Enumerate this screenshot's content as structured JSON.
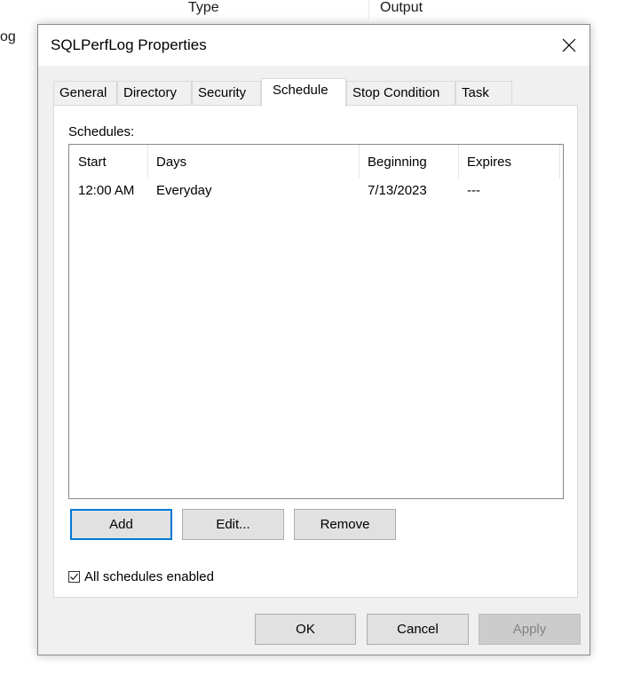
{
  "background": {
    "columns": [
      "Type",
      "Output"
    ],
    "left_fragment": "og"
  },
  "dialog": {
    "title": "SQLPerfLog Properties",
    "tabs": [
      {
        "label": "General"
      },
      {
        "label": "Directory"
      },
      {
        "label": "Security"
      },
      {
        "label": "Schedule",
        "active": true
      },
      {
        "label": "Stop Condition"
      },
      {
        "label": "Task"
      }
    ],
    "schedules_label": "Schedules:",
    "list": {
      "columns": [
        "Start",
        "Days",
        "Beginning",
        "Expires"
      ],
      "rows": [
        {
          "start": "12:00 AM",
          "days": "Everyday",
          "beginning": "7/13/2023",
          "expires": "---"
        }
      ]
    },
    "buttons": {
      "add": "Add",
      "edit": "Edit...",
      "remove": "Remove",
      "ok": "OK",
      "cancel": "Cancel",
      "apply": "Apply"
    },
    "all_enabled": {
      "label": "All schedules enabled",
      "checked": true
    }
  }
}
